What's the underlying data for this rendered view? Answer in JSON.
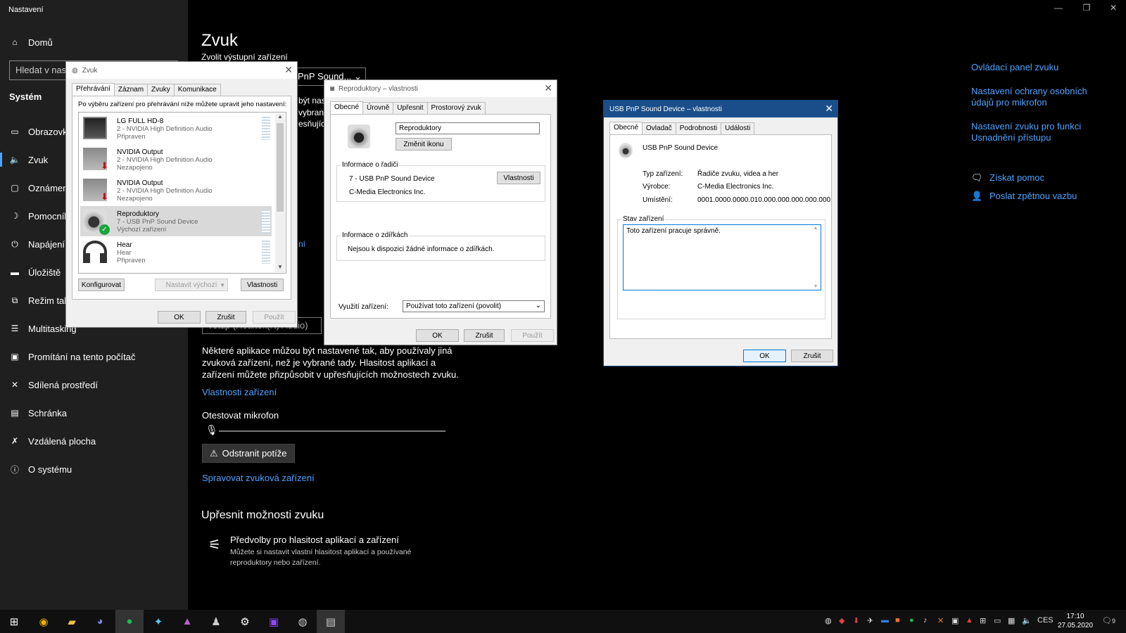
{
  "settings": {
    "app_title": "Nastavení",
    "search_placeholder": "Hledat v nast",
    "system_heading": "Systém",
    "nav": [
      {
        "label": "Domů",
        "icon": "home-icon"
      },
      {
        "label": "Obrazovk",
        "icon": "display-icon"
      },
      {
        "label": "Zvuk",
        "icon": "speaker-icon"
      },
      {
        "label": "Oznámen",
        "icon": "notification-icon"
      },
      {
        "label": "Pomocník",
        "icon": "focus-icon"
      },
      {
        "label": "Napájení a",
        "icon": "power-icon"
      },
      {
        "label": "Úložiště",
        "icon": "storage-icon"
      },
      {
        "label": "Režim tab",
        "icon": "tablet-icon"
      },
      {
        "label": "Multitasking",
        "icon": "multitasking-icon"
      },
      {
        "label": "Promítání na tento počítač",
        "icon": "projecting-icon"
      },
      {
        "label": "Sdílená prostředí",
        "icon": "shared-icon"
      },
      {
        "label": "Schránka",
        "icon": "clipboard-icon"
      },
      {
        "label": "Vzdálená plocha",
        "icon": "remote-icon"
      },
      {
        "label": "O systému",
        "icon": "info-icon"
      }
    ],
    "page_title": "Zvuk",
    "output_label": "Zvolit výstupní zařízení",
    "output_dropdown": "PnP Sound...",
    "input_dropdown": "vstup (Realtek(R) Audio)",
    "partial_texts": [
      "být nast",
      "vybrané",
      "esňujíc"
    ],
    "hidden_link_fragment": "ní",
    "paragraph": "Některé aplikace můžou být nastavené tak, aby používaly jiná zvuková zařízení, než je vybrané tady. Hlasitost aplikací a zařízení můžete přizpůsobit v upřesňujících možnostech zvuku.",
    "device_properties_link": "Vlastnosti zařízení",
    "test_mic_label": "Otestovat mikrofon",
    "fix_button": "Odstranit potíže",
    "manage_devices_link": "Spravovat zvuková zařízení",
    "advanced_heading": "Upřesnit možnosti zvuku",
    "app_volume_title": "Předvolby pro hlasitost aplikací a zařízení",
    "app_volume_desc": "Můžete si nastavit vlastní hlasitost aplikací a používané reproduktory nebo zařízení.",
    "right_links": {
      "sound_panel": "Ovládací panel zvuku",
      "mic_privacy": "Nastavení ochrany osobních údajů pro mikrofon",
      "ease_access": "Nastavení zvuku pro funkci Usnadnění přístupu",
      "get_help": "Získat pomoc",
      "feedback": "Poslat zpětnou vazbu"
    }
  },
  "sound_dialog": {
    "title": "Zvuk",
    "tabs": [
      "Přehrávání",
      "Záznam",
      "Zvuky",
      "Komunikace"
    ],
    "instruction": "Po výběru zařízení pro přehrávání níže můžete upravit jeho nastavení:",
    "devices": [
      {
        "name": "LG FULL HD-8",
        "desc": "2 - NVIDIA High Definition Audio",
        "status": "Připraven"
      },
      {
        "name": "NVIDIA Output",
        "desc": "2 - NVIDIA High Definition Audio",
        "status": "Nezapojeno"
      },
      {
        "name": "NVIDIA Output",
        "desc": "2 - NVIDIA High Definition Audio",
        "status": "Nezapojeno"
      },
      {
        "name": "Reproduktory",
        "desc": "7 - USB PnP Sound Device",
        "status": "Výchozí zařízení"
      },
      {
        "name": "Hear",
        "desc": "Hear",
        "status": "Připraven"
      }
    ],
    "configure": "Konfigurovat",
    "set_default": "Nastavit výchozí",
    "properties": "Vlastnosti",
    "ok": "OK",
    "cancel": "Zrušit",
    "apply": "Použít"
  },
  "speaker_dialog": {
    "title": "Reproduktory – vlastnosti",
    "tabs": [
      "Obecné",
      "Úrovně",
      "Upřesnit",
      "Prostorový zvuk"
    ],
    "name_value": "Reproduktory",
    "change_icon": "Změnit ikonu",
    "controller_group": "Informace o řadiči",
    "controller_name": "7 - USB PnP Sound Device",
    "controller_vendor": "C-Media Electronics Inc.",
    "properties": "Vlastnosti",
    "jack_group": "Informace o zdířkách",
    "jack_info": "Nejsou k dispozici žádné informace o zdířkách.",
    "usage_label": "Využití zařízení:",
    "usage_value": "Používat toto zařízení (povolit)",
    "ok": "OK",
    "cancel": "Zrušit",
    "apply": "Použít"
  },
  "usb_dialog": {
    "title": "USB PnP Sound Device – vlastnosti",
    "tabs": [
      "Obecné",
      "Ovladač",
      "Podrobnosti",
      "Události"
    ],
    "device_name": "USB PnP Sound Device",
    "type_label": "Typ zařízení:",
    "type_value": "Řadiče zvuku, videa a her",
    "vendor_label": "Výrobce:",
    "vendor_value": "C-Media Electronics Inc.",
    "location_label": "Umístění:",
    "location_value": "0001.0000.0000.010.000.000.000.000.000",
    "status_group": "Stav zařízení",
    "status_text": "Toto zařízení pracuje správně.",
    "ok": "OK",
    "cancel": "Zrušit"
  },
  "taskbar": {
    "language": "CES",
    "time": "17:10",
    "date": "27.05.2020",
    "notification_count": "9"
  }
}
